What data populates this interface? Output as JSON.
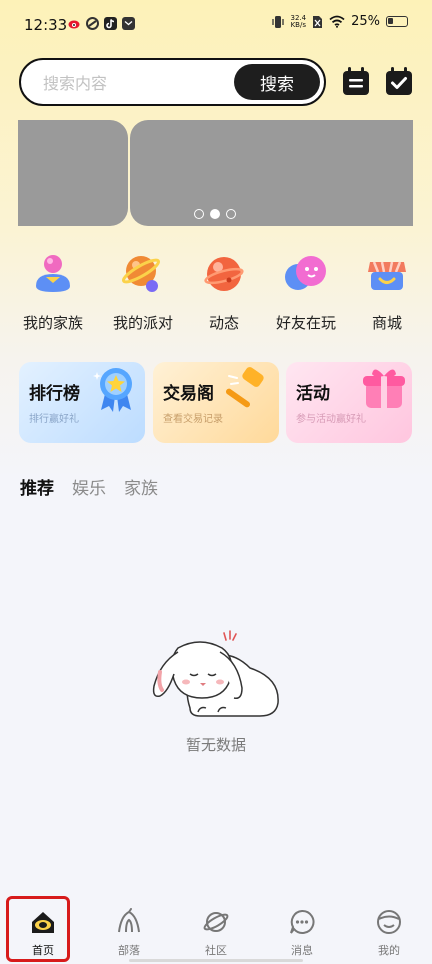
{
  "status_bar": {
    "time": "12:33",
    "net_speed_value": "32.4",
    "net_speed_unit": "KB/s",
    "battery": "25%"
  },
  "search": {
    "placeholder": "搜索内容",
    "button_label": "搜索"
  },
  "banner": {
    "page_count": 3,
    "active_page": 2
  },
  "quick_menu": [
    {
      "label": "我的家族",
      "icon": "family-icon"
    },
    {
      "label": "我的派对",
      "icon": "party-planet-icon"
    },
    {
      "label": "动态",
      "icon": "moments-planet-icon"
    },
    {
      "label": "好友在玩",
      "icon": "friends-playing-icon"
    },
    {
      "label": "商城",
      "icon": "shop-icon"
    }
  ],
  "feature_cards": [
    {
      "title": "排行榜",
      "subtitle": "排行赢好礼",
      "icon": "medal-icon",
      "color": "#cfe6ff"
    },
    {
      "title": "交易阁",
      "subtitle": "查看交易记录",
      "icon": "hammer-icon",
      "color": "#ffe3b3"
    },
    {
      "title": "活动",
      "subtitle": "参与活动赢好礼",
      "icon": "gift-icon",
      "color": "#ffd3e8"
    }
  ],
  "tabs": [
    "推荐",
    "娱乐",
    "家族"
  ],
  "active_tab": "推荐",
  "empty_state": {
    "text": "暂无数据",
    "icon": "sleepy-rabbit-icon"
  },
  "bottom_nav": [
    {
      "label": "首页",
      "icon": "home-icon",
      "active": true
    },
    {
      "label": "部落",
      "icon": "tribe-icon",
      "active": false
    },
    {
      "label": "社区",
      "icon": "community-planet-icon",
      "active": false
    },
    {
      "label": "消息",
      "icon": "message-icon",
      "active": false
    },
    {
      "label": "我的",
      "icon": "profile-icon",
      "active": false
    }
  ],
  "colors": {
    "accent_dark": "#1e1e1e",
    "banner_gray": "#9a9a9a",
    "highlight_red": "#d71b1b"
  }
}
